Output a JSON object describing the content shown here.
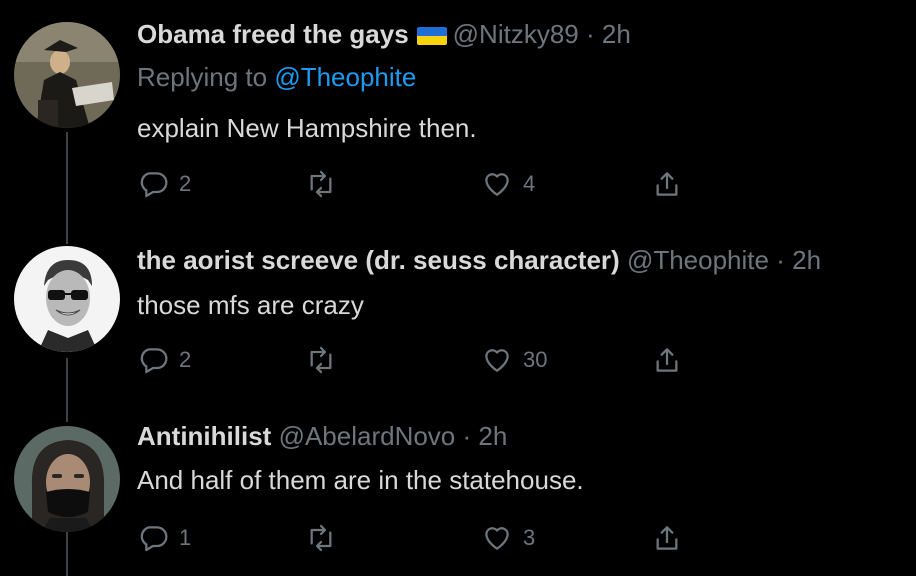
{
  "tweets": [
    {
      "name": "Obama freed the gays",
      "handle": "@Nitzky89",
      "dot": "·",
      "time": "2h",
      "reply_prefix": "Replying to",
      "reply_to": "@Theophite",
      "text": "explain New Hampshire then.",
      "replies": "2",
      "retweets": "",
      "likes": "4",
      "flag": "ukraine-flag-icon"
    },
    {
      "name": "the aorist screeve (dr. seuss character)",
      "handle": "@Theophite",
      "dot": "·",
      "time": "2h",
      "text": "those mfs are crazy",
      "replies": "2",
      "retweets": "",
      "likes": "30"
    },
    {
      "name": "Antinihilist",
      "handle": "@AbelardNovo",
      "dot": "·",
      "time": "2h",
      "text": "And half of them are in the statehouse.",
      "replies": "1",
      "retweets": "",
      "likes": "3"
    }
  ],
  "colors": {
    "background": "#000000",
    "text": "#d9d9d9",
    "muted": "#6e767d",
    "link": "#1d9bf0",
    "thread_line": "#3d4144"
  }
}
